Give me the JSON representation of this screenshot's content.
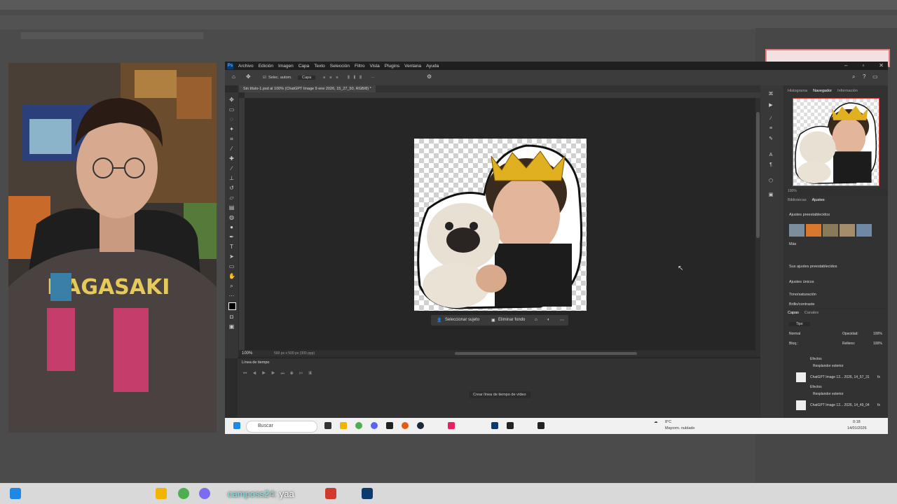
{
  "ps": {
    "menu": [
      "Archivo",
      "Edición",
      "Imagen",
      "Capa",
      "Texto",
      "Selección",
      "Filtro",
      "Vista",
      "Plugins",
      "Ventana",
      "Ayuda"
    ],
    "logo": "Ps",
    "options": {
      "auto_select": "Selec. autom.",
      "layer": "Capa"
    },
    "doc_tab": "Sin título-1.psd al 100% (ChatGPT Image 9 ene 2026, 15_27_50, RGB/8) *",
    "zoom": "100%",
    "doc_size": "500 px x 500 px (300 ppp)",
    "context_bar": {
      "select_subject": "Seleccionar sujeto",
      "remove_bg": "Eliminar fondo"
    },
    "timeline": {
      "title": "Línea de tiempo",
      "create_button": "Crear línea de tiempo de vídeo"
    }
  },
  "right_panel": {
    "nav_tabs": [
      "Histograma",
      "Navegador",
      "Información"
    ],
    "nav_active": "Navegador",
    "nav_zoom": "100%",
    "adj_tabs": [
      "Bibliotecas",
      "Ajustes"
    ],
    "adj_active": "Ajustes",
    "presets_title": "Ajustes preestablecidos",
    "more_label": "Más",
    "your_presets": "Sus ajustes preestablecidos",
    "single_adj": "Ajustes únicos",
    "hue_sat": "Tono/saturación",
    "brightness": "Brillo/contraste",
    "layer_tabs": [
      "Capas",
      "Canales"
    ],
    "layer_kind": "Tipo",
    "blend": "Normal",
    "opacity_label": "Opacidad:",
    "opacity_value": "100%",
    "lock_label": "Bloq.:",
    "fill_label": "Relleno:",
    "fill_value": "100%",
    "layers": [
      {
        "name": "ChatGPT Image 12... 2026, 14_57_31",
        "fx": "fx"
      },
      {
        "name": "ChatGPT Image 12... 2026, 14_49_04",
        "fx": "fx"
      }
    ],
    "effects_label": "Efectos",
    "glow_label": "Resplandor exterior"
  },
  "taskbar": {
    "search_placeholder": "Buscar",
    "weather_temp": "8°C",
    "weather_text": "Mayorm. nublado",
    "time": "0:18",
    "date": "14/01/2026"
  },
  "chat": {
    "user": "camposs24",
    "sep": ":",
    "message": "yaa"
  },
  "colors": {
    "accent": "#1e88e5",
    "ps_dark": "#2b2b2b",
    "chat_name": "#7fe5e0"
  }
}
